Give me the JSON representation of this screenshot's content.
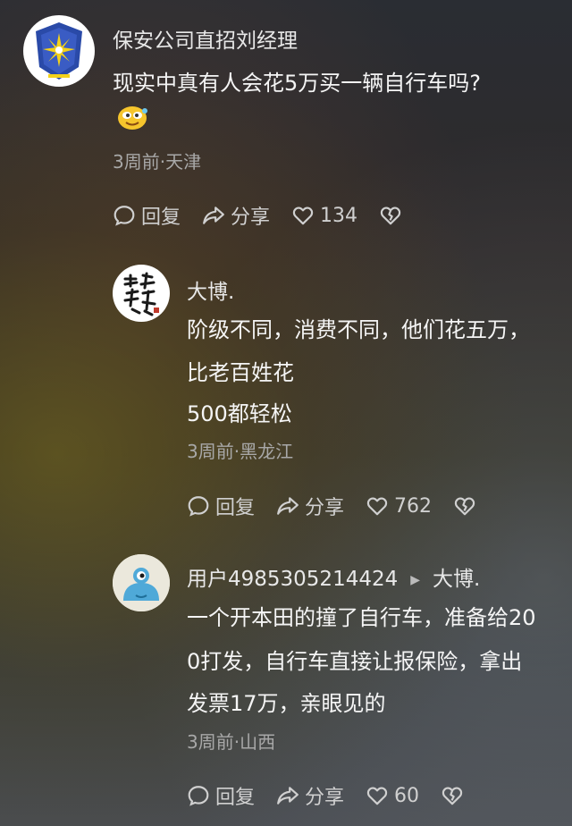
{
  "comments": [
    {
      "username": "保安公司直招刘经理",
      "lines": [
        "现实中真有人会花5万买一辆自行车吗?"
      ],
      "emoji": "laughing-face-icon",
      "meta": "3周前·天津",
      "reply_label": "回复",
      "share_label": "分享",
      "like_count": "134"
    },
    {
      "username": "大博.",
      "lines": [
        "阶级不同，消费不同，他们花五万，",
        "比老百姓花",
        "500都轻松"
      ],
      "meta": "3周前·黑龙江",
      "reply_label": "回复",
      "share_label": "分享",
      "like_count": "762"
    },
    {
      "username": "用户4985305214424",
      "reply_to": "大博.",
      "lines": [
        "一个开本田的撞了自行车，准备给20",
        "0打发，自行车直接让报保险，拿出",
        "发票17万，亲眼见的"
      ],
      "meta": "3周前·山西",
      "reply_label": "回复",
      "share_label": "分享",
      "like_count": "60"
    }
  ],
  "colors": {
    "text": "#f5f5f5",
    "meta": "#a8a8a8",
    "action": "#d0d0d0"
  }
}
